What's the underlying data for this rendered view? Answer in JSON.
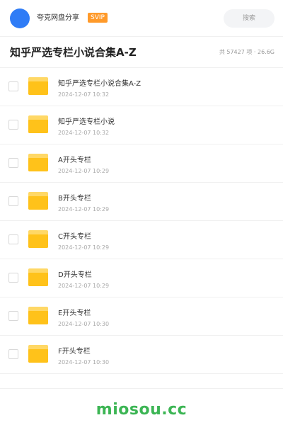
{
  "header": {
    "username": "夸克网盘分享",
    "badge": "SVIP",
    "search_placeholder": "搜索"
  },
  "title": {
    "text": "知乎严选专栏小说合集A-Z",
    "stats": "共 57427 项 · 26.6G"
  },
  "items": [
    {
      "name": "知乎严选专栏小说合集A-Z",
      "date": "2024-12-07 10:32"
    },
    {
      "name": "知乎严选专栏小说",
      "date": "2024-12-07 10:32"
    },
    {
      "name": "A开头专栏",
      "date": "2024-12-07 10:29"
    },
    {
      "name": "B开头专栏",
      "date": "2024-12-07 10:29"
    },
    {
      "name": "C开头专栏",
      "date": "2024-12-07 10:29"
    },
    {
      "name": "D开头专栏",
      "date": "2024-12-07 10:29"
    },
    {
      "name": "E开头专栏",
      "date": "2024-12-07 10:30"
    },
    {
      "name": "F开头专栏",
      "date": "2024-12-07 10:30"
    }
  ],
  "footer": {
    "watermark": "miosou.cc"
  },
  "colors": {
    "avatar": "#2f7cf6",
    "badge": "#ff9a2a",
    "folder": "#ffc21a",
    "watermark": "#3cb554"
  },
  "icons": {
    "folder": "folder-icon",
    "checkbox": "checkbox-icon"
  }
}
